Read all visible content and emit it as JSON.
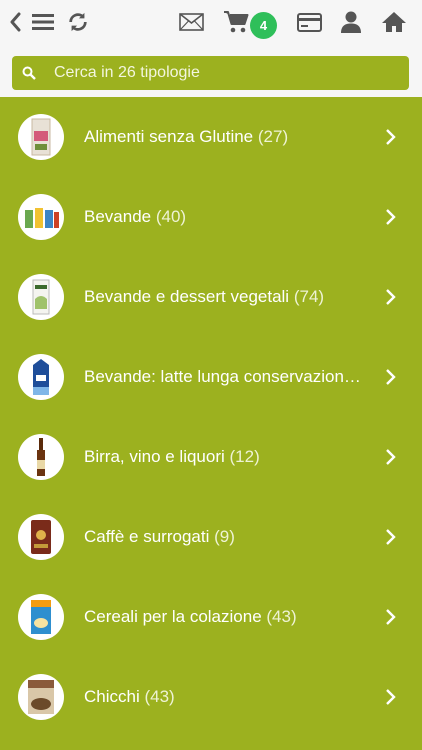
{
  "header": {
    "icons": [
      "chevron-left-icon",
      "menu-icon",
      "refresh-icon",
      "mail-icon",
      "cart-icon",
      "credit-card-icon",
      "user-icon",
      "home-icon"
    ],
    "cart_count": "4"
  },
  "search": {
    "placeholder": "Cerca in 26 tipologie"
  },
  "categories": [
    {
      "name": "Alimenti senza Glutine",
      "count": "(27)"
    },
    {
      "name": "Bevande",
      "count": "(40)"
    },
    {
      "name": "Bevande e dessert vegetali",
      "count": "(74)"
    },
    {
      "name": "Bevande: latte lunga conservazione ...",
      "count": ""
    },
    {
      "name": "Birra, vino e liquori",
      "count": "(12)"
    },
    {
      "name": "Caffè e surrogati",
      "count": "(9)"
    },
    {
      "name": "Cereali per la colazione",
      "count": "(43)"
    },
    {
      "name": "Chicchi",
      "count": "(43)"
    }
  ],
  "colors": {
    "accent": "#9cb11f",
    "badge": "#2fbf5a",
    "topbar": "#f6f6f6",
    "icon": "#5a5a5a"
  }
}
